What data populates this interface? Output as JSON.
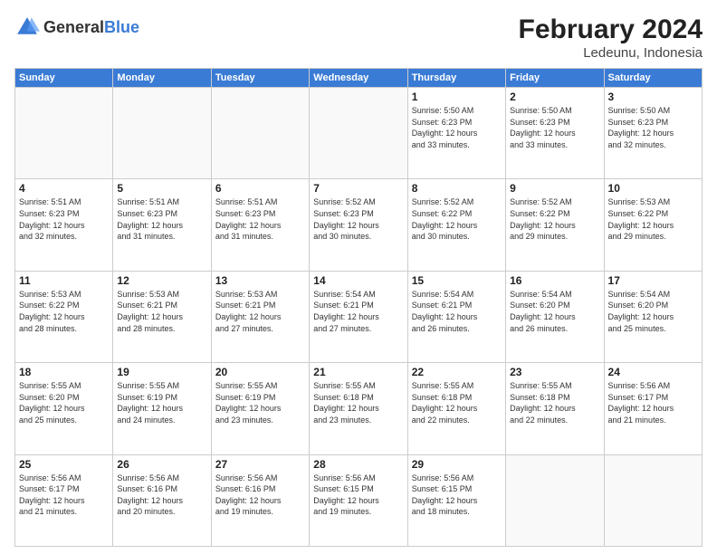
{
  "header": {
    "logo_general": "General",
    "logo_blue": "Blue",
    "month_year": "February 2024",
    "location": "Ledeunu, Indonesia"
  },
  "weekdays": [
    "Sunday",
    "Monday",
    "Tuesday",
    "Wednesday",
    "Thursday",
    "Friday",
    "Saturday"
  ],
  "weeks": [
    [
      {
        "day": "",
        "info": ""
      },
      {
        "day": "",
        "info": ""
      },
      {
        "day": "",
        "info": ""
      },
      {
        "day": "",
        "info": ""
      },
      {
        "day": "1",
        "info": "Sunrise: 5:50 AM\nSunset: 6:23 PM\nDaylight: 12 hours\nand 33 minutes."
      },
      {
        "day": "2",
        "info": "Sunrise: 5:50 AM\nSunset: 6:23 PM\nDaylight: 12 hours\nand 33 minutes."
      },
      {
        "day": "3",
        "info": "Sunrise: 5:50 AM\nSunset: 6:23 PM\nDaylight: 12 hours\nand 32 minutes."
      }
    ],
    [
      {
        "day": "4",
        "info": "Sunrise: 5:51 AM\nSunset: 6:23 PM\nDaylight: 12 hours\nand 32 minutes."
      },
      {
        "day": "5",
        "info": "Sunrise: 5:51 AM\nSunset: 6:23 PM\nDaylight: 12 hours\nand 31 minutes."
      },
      {
        "day": "6",
        "info": "Sunrise: 5:51 AM\nSunset: 6:23 PM\nDaylight: 12 hours\nand 31 minutes."
      },
      {
        "day": "7",
        "info": "Sunrise: 5:52 AM\nSunset: 6:23 PM\nDaylight: 12 hours\nand 30 minutes."
      },
      {
        "day": "8",
        "info": "Sunrise: 5:52 AM\nSunset: 6:22 PM\nDaylight: 12 hours\nand 30 minutes."
      },
      {
        "day": "9",
        "info": "Sunrise: 5:52 AM\nSunset: 6:22 PM\nDaylight: 12 hours\nand 29 minutes."
      },
      {
        "day": "10",
        "info": "Sunrise: 5:53 AM\nSunset: 6:22 PM\nDaylight: 12 hours\nand 29 minutes."
      }
    ],
    [
      {
        "day": "11",
        "info": "Sunrise: 5:53 AM\nSunset: 6:22 PM\nDaylight: 12 hours\nand 28 minutes."
      },
      {
        "day": "12",
        "info": "Sunrise: 5:53 AM\nSunset: 6:21 PM\nDaylight: 12 hours\nand 28 minutes."
      },
      {
        "day": "13",
        "info": "Sunrise: 5:53 AM\nSunset: 6:21 PM\nDaylight: 12 hours\nand 27 minutes."
      },
      {
        "day": "14",
        "info": "Sunrise: 5:54 AM\nSunset: 6:21 PM\nDaylight: 12 hours\nand 27 minutes."
      },
      {
        "day": "15",
        "info": "Sunrise: 5:54 AM\nSunset: 6:21 PM\nDaylight: 12 hours\nand 26 minutes."
      },
      {
        "day": "16",
        "info": "Sunrise: 5:54 AM\nSunset: 6:20 PM\nDaylight: 12 hours\nand 26 minutes."
      },
      {
        "day": "17",
        "info": "Sunrise: 5:54 AM\nSunset: 6:20 PM\nDaylight: 12 hours\nand 25 minutes."
      }
    ],
    [
      {
        "day": "18",
        "info": "Sunrise: 5:55 AM\nSunset: 6:20 PM\nDaylight: 12 hours\nand 25 minutes."
      },
      {
        "day": "19",
        "info": "Sunrise: 5:55 AM\nSunset: 6:19 PM\nDaylight: 12 hours\nand 24 minutes."
      },
      {
        "day": "20",
        "info": "Sunrise: 5:55 AM\nSunset: 6:19 PM\nDaylight: 12 hours\nand 23 minutes."
      },
      {
        "day": "21",
        "info": "Sunrise: 5:55 AM\nSunset: 6:18 PM\nDaylight: 12 hours\nand 23 minutes."
      },
      {
        "day": "22",
        "info": "Sunrise: 5:55 AM\nSunset: 6:18 PM\nDaylight: 12 hours\nand 22 minutes."
      },
      {
        "day": "23",
        "info": "Sunrise: 5:55 AM\nSunset: 6:18 PM\nDaylight: 12 hours\nand 22 minutes."
      },
      {
        "day": "24",
        "info": "Sunrise: 5:56 AM\nSunset: 6:17 PM\nDaylight: 12 hours\nand 21 minutes."
      }
    ],
    [
      {
        "day": "25",
        "info": "Sunrise: 5:56 AM\nSunset: 6:17 PM\nDaylight: 12 hours\nand 21 minutes."
      },
      {
        "day": "26",
        "info": "Sunrise: 5:56 AM\nSunset: 6:16 PM\nDaylight: 12 hours\nand 20 minutes."
      },
      {
        "day": "27",
        "info": "Sunrise: 5:56 AM\nSunset: 6:16 PM\nDaylight: 12 hours\nand 19 minutes."
      },
      {
        "day": "28",
        "info": "Sunrise: 5:56 AM\nSunset: 6:15 PM\nDaylight: 12 hours\nand 19 minutes."
      },
      {
        "day": "29",
        "info": "Sunrise: 5:56 AM\nSunset: 6:15 PM\nDaylight: 12 hours\nand 18 minutes."
      },
      {
        "day": "",
        "info": ""
      },
      {
        "day": "",
        "info": ""
      }
    ]
  ]
}
